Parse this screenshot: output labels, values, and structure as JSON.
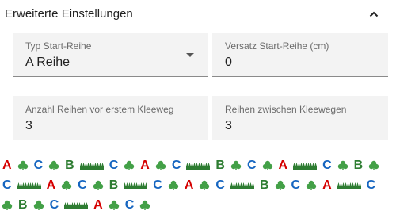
{
  "section": {
    "title": "Erweiterte Einstellungen",
    "toggle_icon": "chevron-up-icon"
  },
  "fields": {
    "start_row_type": {
      "label": "Typ Start-Reihe",
      "value": "A Reihe",
      "icon": "dropdown-caret-icon"
    },
    "start_row_offset": {
      "label": "Versatz Start-Reihe (cm)",
      "value": "0"
    },
    "rows_before_first_path": {
      "label": "Anzahl Reihen vor erstem Kleeweg",
      "value": "3"
    },
    "rows_between_paths": {
      "label": "Reihen zwischen Kleewegen",
      "value": "3"
    }
  },
  "colors": {
    "A": "#d50000",
    "B": "#2e7d32",
    "C": "#1565c0",
    "clover": "#43a047",
    "grass": "#2e7d32"
  },
  "pattern": {
    "legend_icons": {
      "K": "clover-icon",
      "G": "grass-path-icon"
    },
    "rows": [
      [
        "A",
        "K",
        "C",
        "K",
        "B",
        "G",
        "C",
        "K",
        "A",
        "K",
        "C",
        "G",
        "B",
        "K",
        "C",
        "K",
        "A",
        "G",
        "C",
        "K",
        "B",
        "K"
      ],
      [
        "C",
        "G",
        "A",
        "K",
        "C",
        "K",
        "B",
        "G",
        "C",
        "K",
        "A",
        "K",
        "C",
        "G",
        "B",
        "K",
        "C",
        "K",
        "A",
        "G",
        "C"
      ],
      [
        "K",
        "B",
        "K",
        "C",
        "G",
        "A",
        "K",
        "C",
        "K"
      ]
    ]
  }
}
